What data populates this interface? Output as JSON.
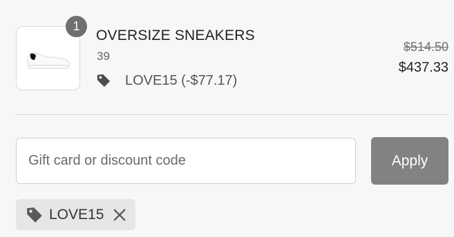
{
  "cart_item": {
    "quantity": "1",
    "name": "OVERSIZE SNEAKERS",
    "variant": "39",
    "discount_text": "LOVE15 (-$77.17)",
    "original_price": "$514.50",
    "final_price": "$437.33",
    "image_icon": "sneaker-image"
  },
  "discount_form": {
    "input_placeholder": "Gift card or discount code",
    "input_value": "",
    "apply_label": "Apply"
  },
  "applied_code": {
    "code": "LOVE15",
    "tag_icon": "tag-icon",
    "remove_icon": "close-icon"
  },
  "colors": {
    "badge": "#6f6f6f",
    "apply_button": "#828282",
    "chip_background": "#e6e6e6",
    "page_background": "#f7f7f7"
  }
}
